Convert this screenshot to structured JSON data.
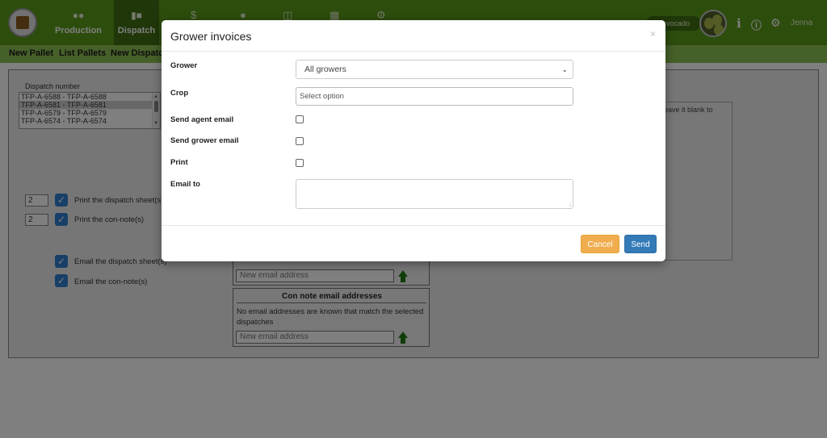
{
  "nav": {
    "items": [
      {
        "label": "Production",
        "icon": "users-icon"
      },
      {
        "label": "Dispatch",
        "icon": "truck-icon"
      }
    ],
    "icons_only": [
      "dollar-icon",
      "person-icon",
      "table-icon",
      "grid-icon",
      "gear-icon"
    ],
    "crop_pill": "vocado",
    "user_name": "Jenna"
  },
  "subnav": {
    "links": [
      "New Pallet",
      "List Pallets",
      "New Dispatch"
    ]
  },
  "dispatch": {
    "label": "Dispatch number",
    "rows": [
      {
        "text": "TFP-A-6588 - TFP-A-6588",
        "selected": false
      },
      {
        "text": "TFP-A-6581 - TFP-A-6581",
        "selected": true
      },
      {
        "text": "TFP-A-6579 - TFP-A-6579",
        "selected": false
      },
      {
        "text": "TFP-A-6574 - TFP-A-6574",
        "selected": false
      }
    ]
  },
  "options": {
    "print_dispatch_count": "2",
    "print_dispatch_label": "Print the dispatch sheet(s)",
    "print_connote_count": "2",
    "print_connote_label": "Print the con-note(s)",
    "email_dispatch_label": "Email the dispatch sheet(s)",
    "email_connote_label": "Email the con-note(s)"
  },
  "right_hint": "eave it blank to",
  "emails": {
    "new_email_placeholder": "New email address",
    "con_note_title": "Con note email addresses",
    "con_note_msg": "No email addresses are known that match the selected dispatches"
  },
  "modal": {
    "title": "Grower invoices",
    "close": "×",
    "grower_label": "Grower",
    "grower_value": "All growers",
    "crop_label": "Crop",
    "crop_placeholder": "Select option",
    "send_agent_label": "Send agent email",
    "send_grower_label": "Send grower email",
    "print_label": "Print",
    "email_to_label": "Email to",
    "cancel": "Cancel",
    "send": "Send"
  },
  "colors": {
    "topbar": "#5a9a1a",
    "subbar": "#8cc152",
    "cancel": "#f0ad4e",
    "send": "#337ab7",
    "checkbox": "#2e7ed0"
  }
}
